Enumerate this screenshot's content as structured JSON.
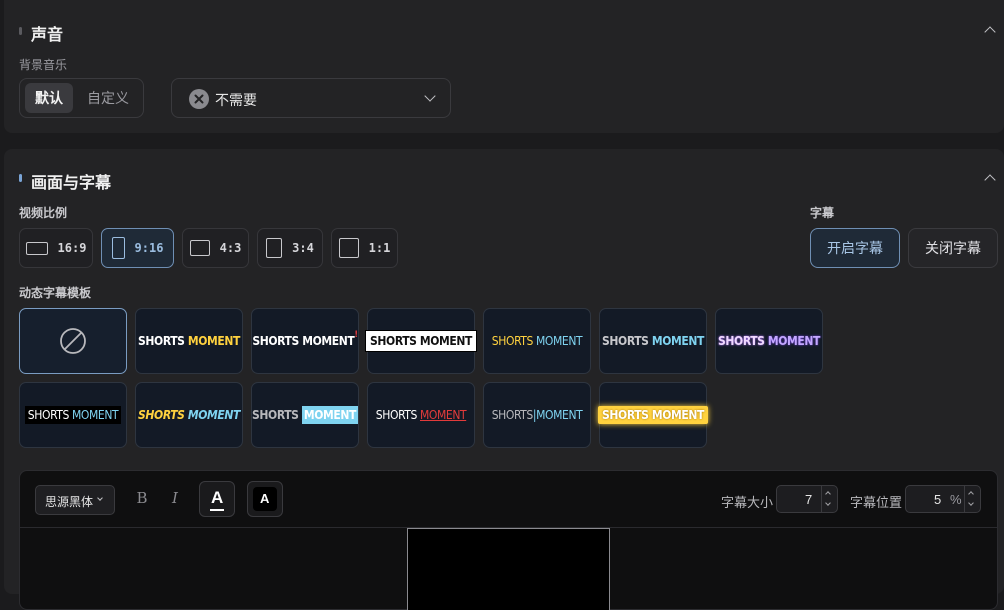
{
  "sound": {
    "title": "声音",
    "bgm_label": "背景音乐",
    "bgm_modes": [
      "默认",
      "自定义"
    ],
    "bgm_selected_mode": "默认",
    "bgm_select_value": "不需要"
  },
  "picture": {
    "title": "画面与字幕",
    "ratio_label": "视频比例",
    "ratios": [
      "16:9",
      "9:16",
      "4:3",
      "3:4",
      "1:1"
    ],
    "ratio_selected": "9:16",
    "subtitle_label": "字幕",
    "subtitle_on": "开启字幕",
    "subtitle_off": "关闭字幕",
    "template_label": "动态字幕模板",
    "template_word1": "SHORTS",
    "template_word2": "MOMENT",
    "editor": {
      "font_family": "思源黑体",
      "bold_label": "B",
      "italic_label": "I",
      "color_a_label": "A",
      "stroke_a_label": "A",
      "size_label": "字幕大小",
      "size_value": "7",
      "position_label": "字幕位置",
      "position_value": "5",
      "position_unit": "%"
    }
  },
  "colors": {
    "accent_blue": "#6f8fb4",
    "template_yellow": "#ffd23f",
    "template_cyan": "#7fd3f0",
    "template_red": "#e23b3b"
  }
}
